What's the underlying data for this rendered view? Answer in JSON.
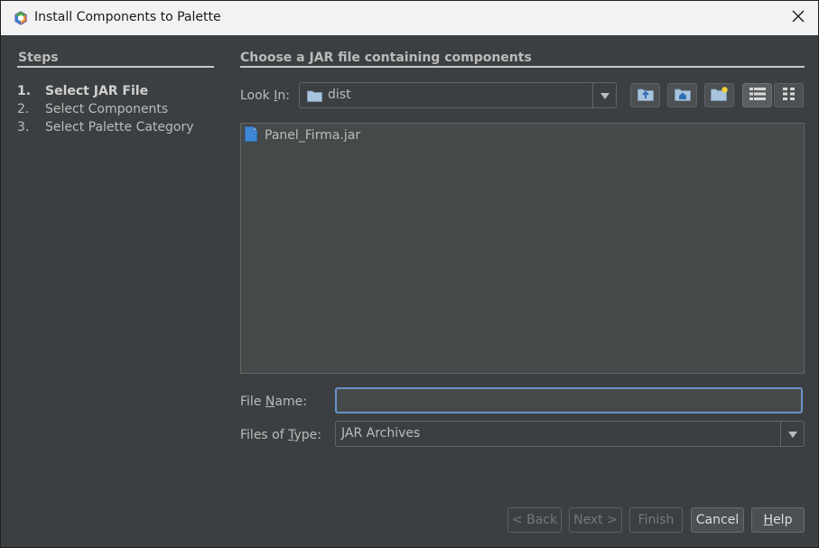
{
  "window": {
    "title": "Install Components to Palette"
  },
  "steps": {
    "title": "Steps",
    "items": [
      {
        "num": "1.",
        "label": "Select JAR File",
        "active": true
      },
      {
        "num": "2.",
        "label": "Select Components",
        "active": false
      },
      {
        "num": "3.",
        "label": "Select Palette Category",
        "active": false
      }
    ]
  },
  "main": {
    "title": "Choose a JAR file containing components",
    "look_in": {
      "label_pre": "Look ",
      "label_mnemonic": "I",
      "label_post": "n:",
      "value": "dist"
    },
    "toolbar": {
      "icons": [
        "up-one-level-icon",
        "home-icon",
        "new-folder-icon",
        "list-view-icon",
        "details-view-icon"
      ]
    },
    "files": [
      {
        "name": "Panel_Firma.jar",
        "icon": "file-icon"
      }
    ],
    "file_name": {
      "label_pre": "File ",
      "label_mnemonic": "N",
      "label_post": "ame:",
      "value": ""
    },
    "files_of_type": {
      "label_pre": "Files of ",
      "label_mnemonic": "T",
      "label_post": "ype:",
      "value": "JAR Archives"
    }
  },
  "buttons": {
    "back": "< Back",
    "next": "Next >",
    "finish": "Finish",
    "cancel": "Cancel",
    "help_mnemonic": "H",
    "help_rest": "elp"
  },
  "colors": {
    "background": "#3c3f41",
    "list_background": "#45494a",
    "focus_border": "#6a93c7",
    "file_icon": "#3e86d6"
  }
}
